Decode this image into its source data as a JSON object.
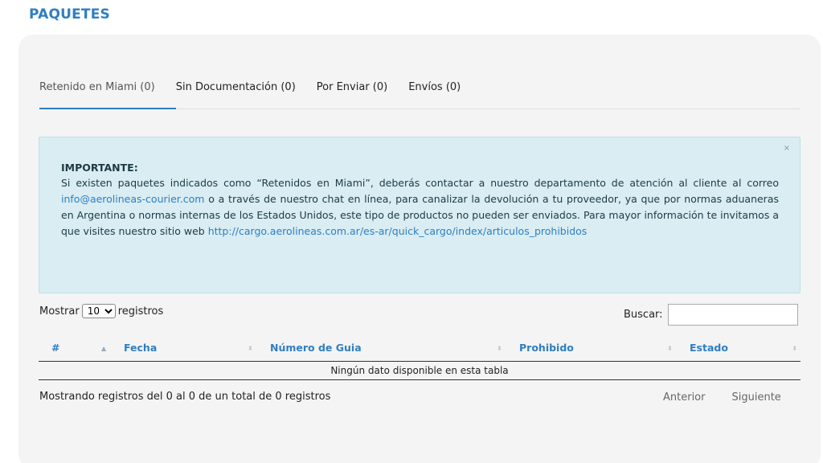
{
  "page": {
    "title": "PAQUETES"
  },
  "tabs": [
    {
      "label": "Retenido en Miami (0)",
      "active": true
    },
    {
      "label": "Sin Documentación (0)",
      "active": false
    },
    {
      "label": "Por Enviar (0)",
      "active": false
    },
    {
      "label": "Envíos (0)",
      "active": false
    }
  ],
  "alert": {
    "close": "×",
    "title": "IMPORTANTE:",
    "text_1": "Si existen paquetes indicados como “Retenidos en Miami”, deberás contactar a nuestro departamento de atención al cliente al correo ",
    "email": "info@aerolineas-courier.com",
    "text_2": " o a través de nuestro chat en línea, para canalizar la devolución a tu proveedor, ya que por normas aduaneras en Argentina o normas internas de los Estados Unidos, este tipo de productos no pueden ser enviados. Para mayor información te invitamos a que visites nuestro sitio web ",
    "link": "http://cargo.aerolineas.com.ar/es-ar/quick_cargo/index/articulos_prohibidos"
  },
  "length_menu": {
    "prefix": "Mostrar",
    "selected": "10",
    "suffix": "registros"
  },
  "search": {
    "label": "Buscar:",
    "value": ""
  },
  "table": {
    "columns": [
      "#",
      "Fecha",
      "Número de Guia",
      "Prohibido",
      "Estado"
    ],
    "empty_message": "Ningún dato disponible en esta tabla"
  },
  "info": "Mostrando registros del 0 al 0 de un total de 0 registros",
  "pagination": {
    "previous": "Anterior",
    "next": "Siguiente"
  },
  "colors": {
    "accent": "#2f7ec1",
    "alert_bg": "#d9edf3",
    "card_bg": "#f4f4f4"
  }
}
